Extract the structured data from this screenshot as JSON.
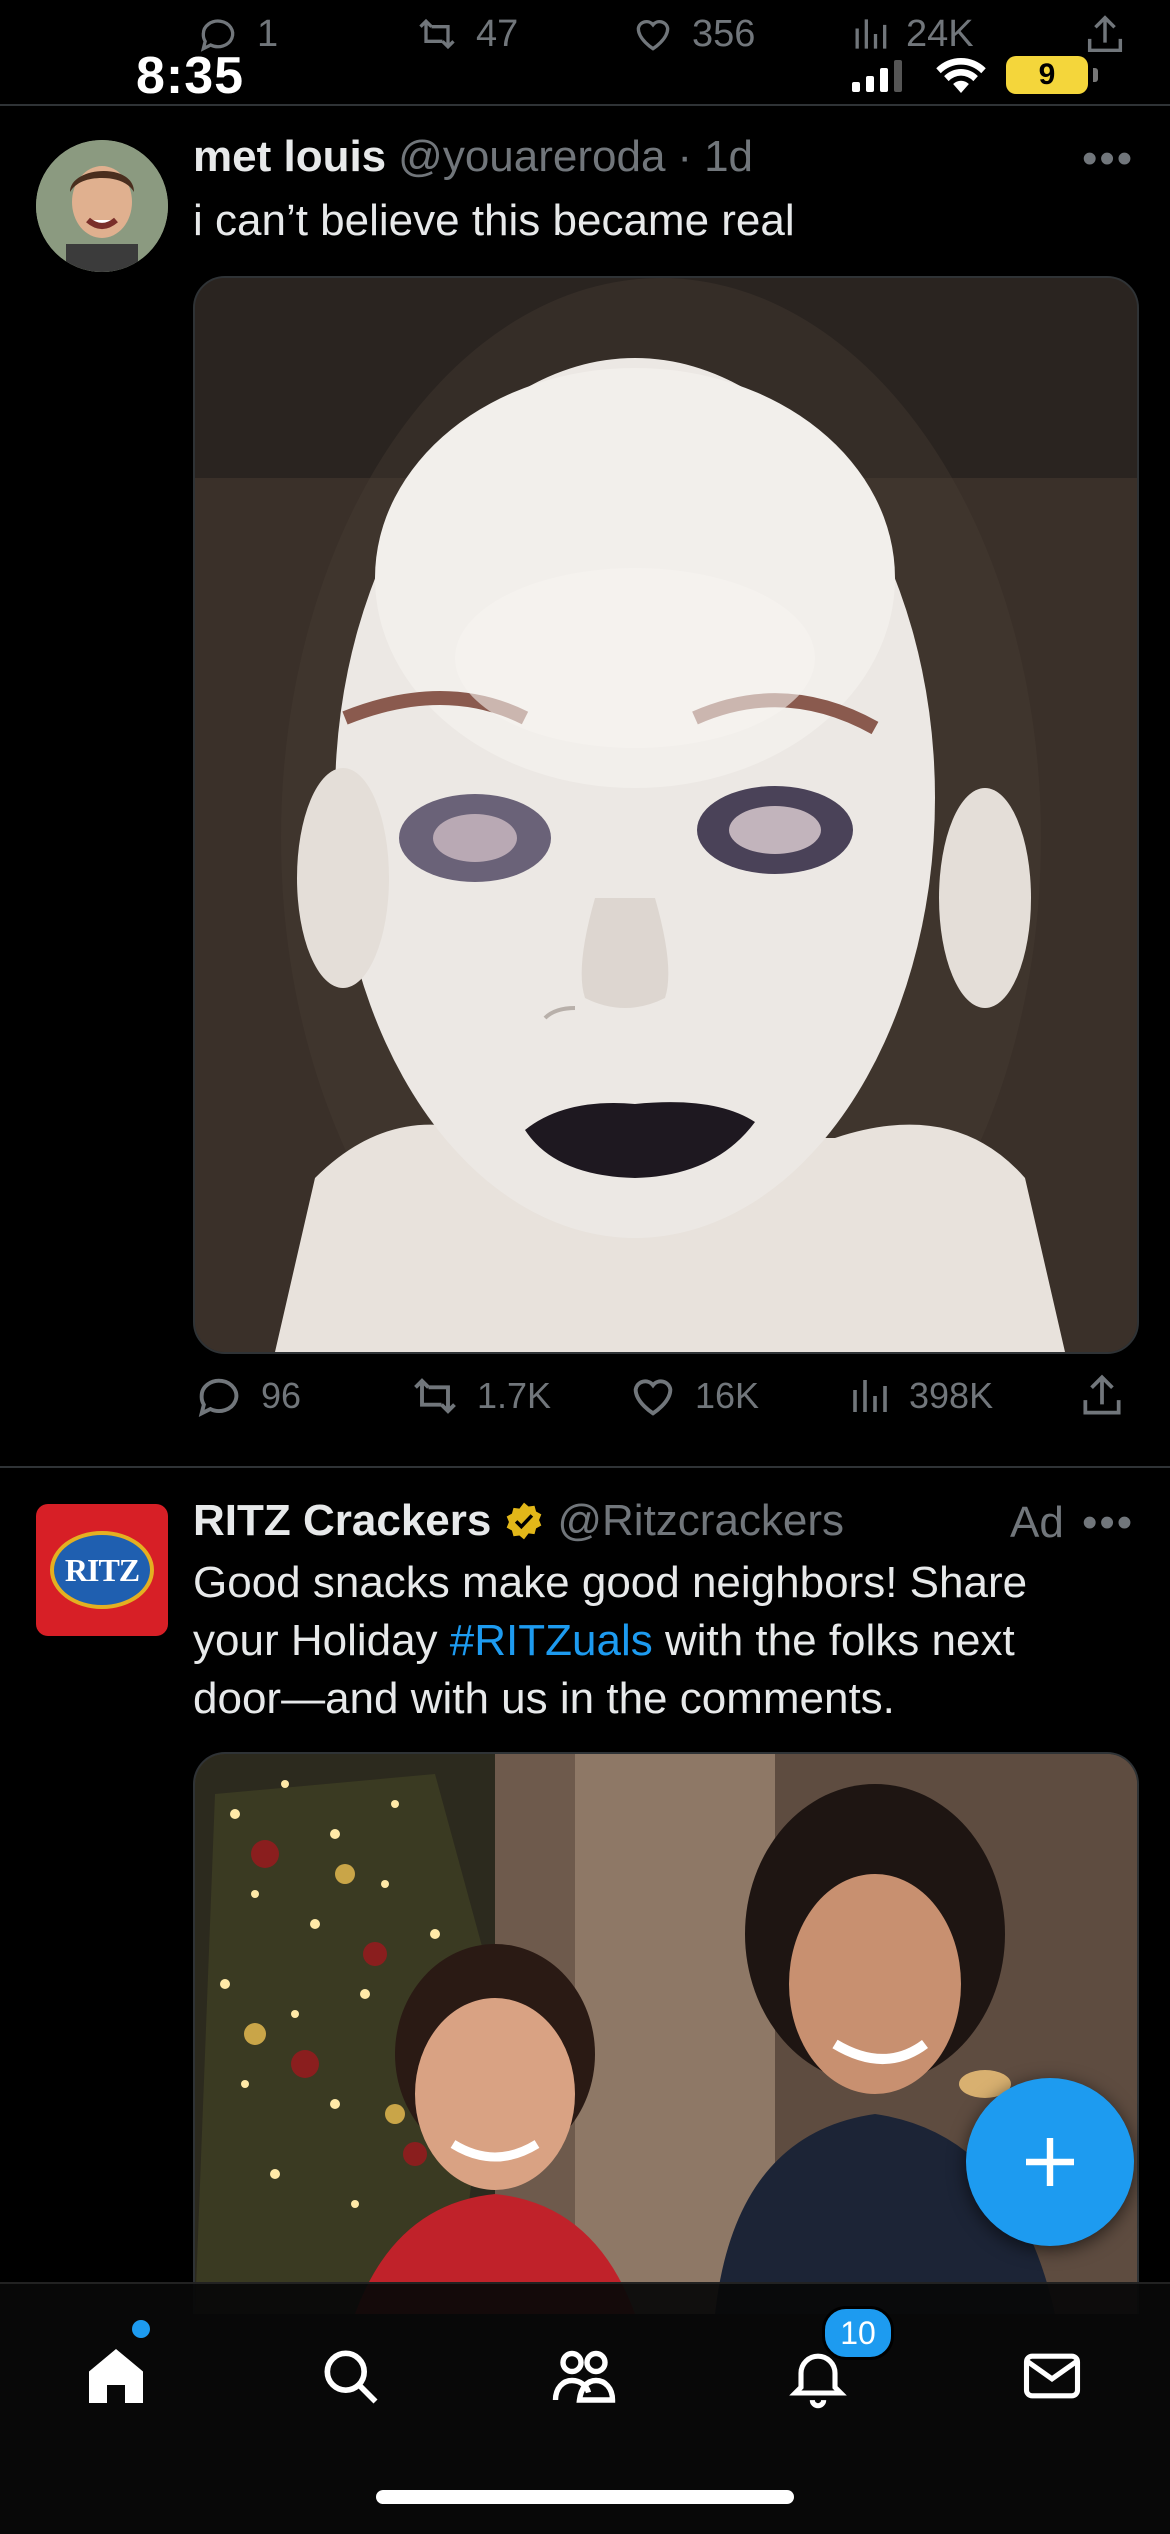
{
  "status_bar": {
    "time": "8:35",
    "battery": "9"
  },
  "ghost_actions": {
    "replies": "1",
    "reposts": "47",
    "likes": "356",
    "views": "24K"
  },
  "tweet1": {
    "name": "met louis",
    "handle": "@youareroda",
    "dot": "·",
    "age": "1d",
    "text": "i can’t believe this became real",
    "actions": {
      "replies": "96",
      "reposts": "1.7K",
      "likes": "16K",
      "views": "398K"
    }
  },
  "tweet2": {
    "name": "RITZ Crackers",
    "handle": "@Ritzcrackers",
    "ad_label": "Ad",
    "avatar_text": "RITZ",
    "text_a": "Good snacks make good neighbors! Share your Holiday ",
    "hashtag": "#RITZuals",
    "text_b": " with the folks next door—and with us in the comments."
  },
  "tabbar": {
    "notifications_count": "10"
  },
  "colors": {
    "accent": "#1d9bf0",
    "muted": "#71767b",
    "ritz_red": "#d71f26",
    "verified_gold": "#e2b719"
  }
}
